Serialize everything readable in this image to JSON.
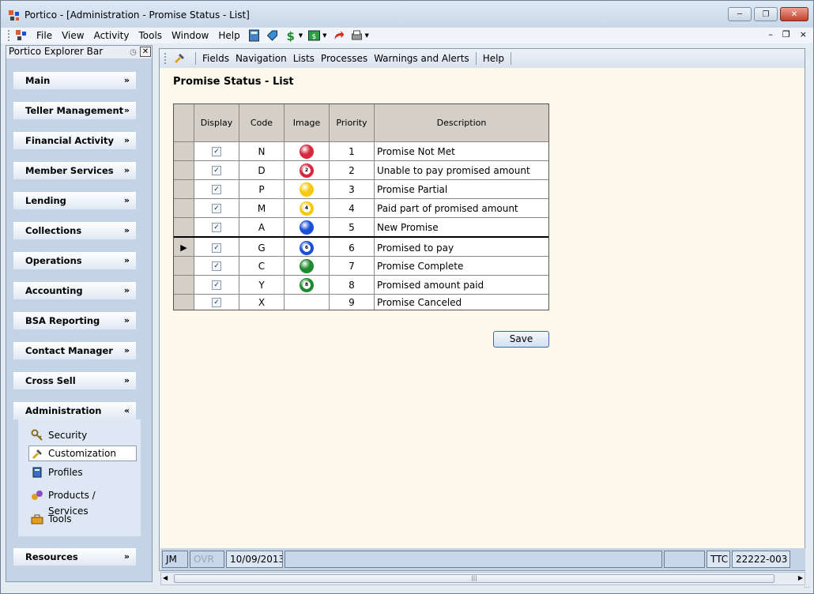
{
  "window": {
    "title": "Portico - [Administration - Promise Status - List]",
    "minimize_icon": "minimize-icon",
    "maximize_icon": "restore-icon",
    "close_icon": "close-icon"
  },
  "menubar": {
    "items": [
      "File",
      "View",
      "Activity",
      "Tools",
      "Window",
      "Help"
    ],
    "mdi_controls": [
      "–",
      "Ḋ",
      "×"
    ]
  },
  "explorer": {
    "title": "Portico Explorer Bar",
    "groups": [
      {
        "label": "Main"
      },
      {
        "label": "Teller Management"
      },
      {
        "label": "Financial Activity"
      },
      {
        "label": "Member Services"
      },
      {
        "label": "Lending"
      },
      {
        "label": "Collections"
      },
      {
        "label": "Operations"
      },
      {
        "label": "Accounting"
      },
      {
        "label": "BSA Reporting"
      },
      {
        "label": "Contact Manager"
      },
      {
        "label": "Cross Sell"
      },
      {
        "label": "Administration"
      },
      {
        "label": "Resources"
      }
    ],
    "admin_items": [
      {
        "label": "Security",
        "icon": "key-icon"
      },
      {
        "label": "Customization",
        "icon": "customization-icon"
      },
      {
        "label": "Profiles",
        "icon": "profiles-icon"
      },
      {
        "label": "Products / Services",
        "icon": "products-icon"
      },
      {
        "label": "Tools",
        "icon": "toolbox-icon"
      }
    ]
  },
  "content_toolbar": {
    "items": [
      "Fields",
      "Navigation",
      "Lists",
      "Processes",
      "Warnings and Alerts",
      "Help"
    ]
  },
  "page": {
    "title": "Promise Status - List",
    "save_label": "Save"
  },
  "grid": {
    "columns": [
      "Display",
      "Code",
      "Image",
      "Priority",
      "Description"
    ],
    "rows": [
      {
        "display": true,
        "code": "N",
        "image": {
          "color": "#d7263d",
          "number": ""
        },
        "priority": "1",
        "description": "Promise Not Met"
      },
      {
        "display": true,
        "code": "D",
        "image": {
          "color": "#d7263d",
          "number": "2"
        },
        "priority": "2",
        "description": "Unable to pay promised amount"
      },
      {
        "display": true,
        "code": "P",
        "image": {
          "color": "#f6c90e",
          "number": ""
        },
        "priority": "3",
        "description": "Promise Partial"
      },
      {
        "display": true,
        "code": "M",
        "image": {
          "color": "#f6c90e",
          "number": "4"
        },
        "priority": "4",
        "description": "Paid part of promised amount"
      },
      {
        "display": true,
        "code": "A",
        "image": {
          "color": "#1a4fd6",
          "number": ""
        },
        "priority": "5",
        "description": "New Promise"
      },
      {
        "display": true,
        "code": "G",
        "image": {
          "color": "#1a4fd6",
          "number": "6"
        },
        "priority": "6",
        "description": "Promised to pay"
      },
      {
        "display": true,
        "code": "C",
        "image": {
          "color": "#1e8a2e",
          "number": ""
        },
        "priority": "7",
        "description": "Promise Complete"
      },
      {
        "display": true,
        "code": "Y",
        "image": {
          "color": "#1e8a2e",
          "number": "8"
        },
        "priority": "8",
        "description": "Promised amount paid"
      },
      {
        "display": true,
        "code": "X",
        "image": null,
        "priority": "9",
        "description": "Promise Canceled"
      }
    ],
    "current_row": 5
  },
  "statusbar": {
    "user": "JM",
    "ovr": "OVR",
    "date": "10/09/2013",
    "ttc": "TTC",
    "branch": "22222-003"
  }
}
